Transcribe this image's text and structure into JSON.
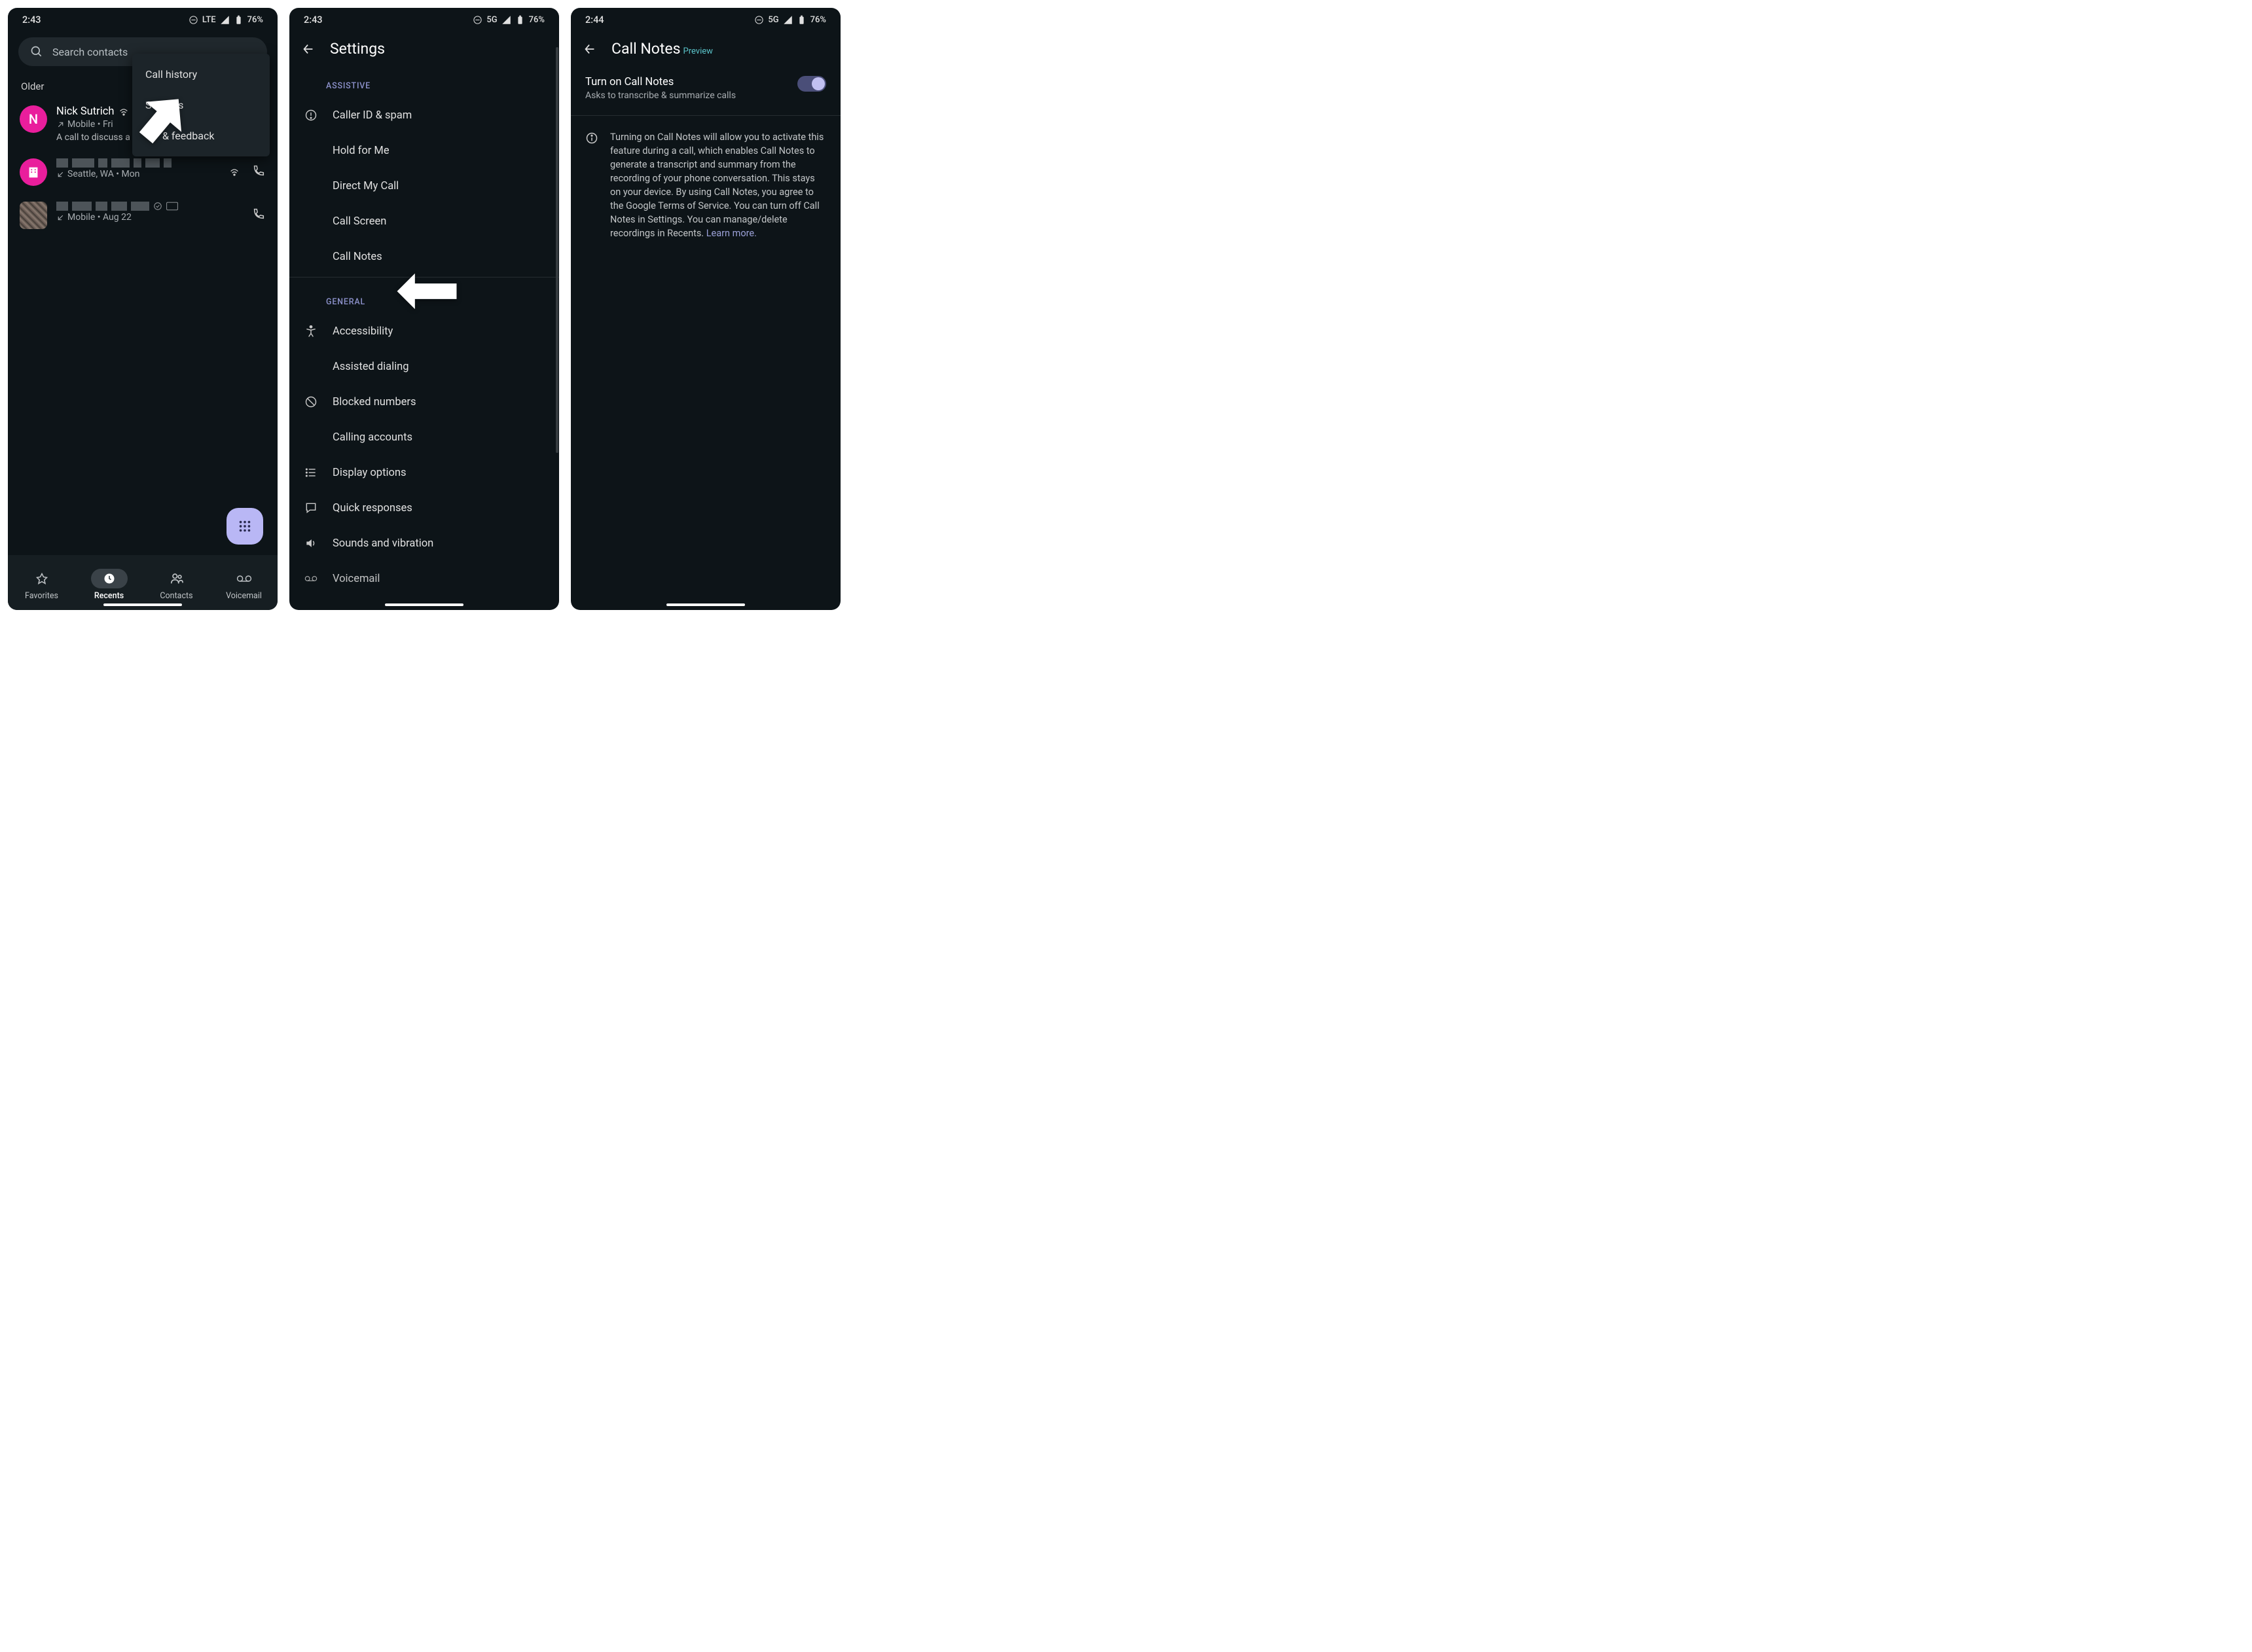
{
  "screen1": {
    "status": {
      "time": "2:43",
      "network": "LTE",
      "battery": "76%"
    },
    "search_placeholder": "Search contacts",
    "menu": {
      "call_history": "Call history",
      "settings": "Settings",
      "help": "& feedback"
    },
    "section_older": "Older",
    "calls": [
      {
        "initial": "N",
        "name": "Nick Sutrich",
        "meta": "Mobile • Fri",
        "note": "A call to discuss a new foldable phone, th…"
      },
      {
        "meta": "Seattle, WA • Mon"
      },
      {
        "meta": "Mobile • Aug 22"
      }
    ],
    "nav": {
      "favorites": "Favorites",
      "recents": "Recents",
      "contacts": "Contacts",
      "voicemail": "Voicemail"
    }
  },
  "screen2": {
    "status": {
      "time": "2:43",
      "network": "5G",
      "battery": "76%"
    },
    "title": "Settings",
    "section_assistive": "ASSISTIVE",
    "section_general": "GENERAL",
    "items": {
      "caller_id": "Caller ID & spam",
      "hold": "Hold for Me",
      "direct": "Direct My Call",
      "callscreen": "Call Screen",
      "callnotes": "Call Notes",
      "accessibility": "Accessibility",
      "assisted": "Assisted dialing",
      "blocked": "Blocked numbers",
      "accounts": "Calling accounts",
      "display": "Display options",
      "quick": "Quick responses",
      "sounds": "Sounds and vibration",
      "voicemail": "Voicemail"
    }
  },
  "screen3": {
    "status": {
      "time": "2:44",
      "network": "5G",
      "battery": "76%"
    },
    "title": "Call Notes",
    "preview": "Preview",
    "toggle_title": "Turn on Call Notes",
    "toggle_sub": "Asks to transcribe & summarize calls",
    "info": "Turning on Call Notes will allow you to activate this feature during a call, which enables Call Notes to generate a transcript and summary from the recording of your phone conversation. This stays on your device. By using Call Notes, you agree to the Google Terms of Service. You can turn off Call Notes in Settings. You can manage/delete recordings in Recents. ",
    "learn_more": "Learn more."
  }
}
